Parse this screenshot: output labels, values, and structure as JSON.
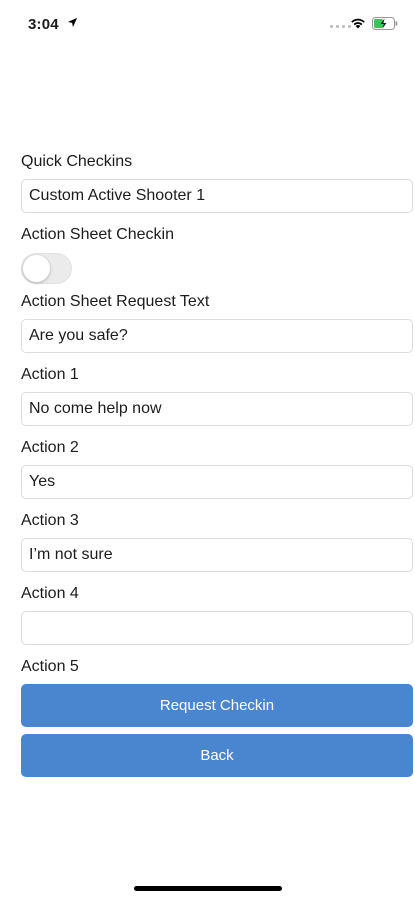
{
  "status_bar": {
    "time": "3:04",
    "icons": [
      "location-arrow-icon",
      "signal-dots-icon",
      "wifi-icon",
      "battery-charging-icon"
    ],
    "battery_color": "#34c759"
  },
  "form": {
    "quick_checkins": {
      "label": "Quick Checkins",
      "value": "Custom Active Shooter 1"
    },
    "action_sheet_checkin": {
      "label": "Action Sheet Checkin",
      "enabled": false
    },
    "request_text": {
      "label": "Action Sheet Request Text",
      "value": "Are you safe?"
    },
    "actions": [
      {
        "label": "Action 1",
        "value": "No come help now"
      },
      {
        "label": "Action 2",
        "value": "Yes"
      },
      {
        "label": "Action 3",
        "value": "I’m not sure"
      },
      {
        "label": "Action 4",
        "value": ""
      },
      {
        "label": "Action 5",
        "value": ""
      }
    ]
  },
  "buttons": {
    "request_checkin": "Request Checkin",
    "back": "Back"
  },
  "colors": {
    "button_bg": "#4a86d0",
    "button_text": "#ffffff",
    "input_border": "#dcdcdc"
  }
}
